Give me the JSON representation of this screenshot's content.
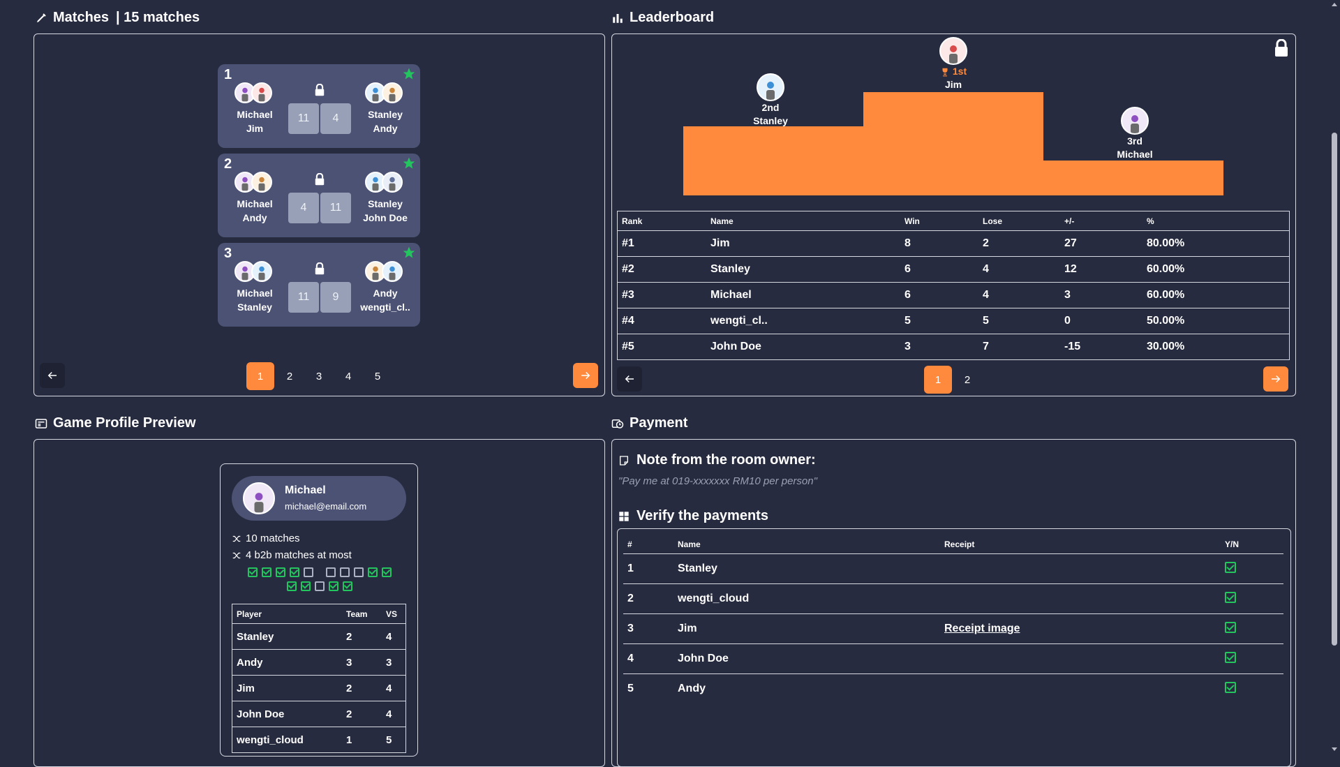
{
  "matches": {
    "title": "Matches",
    "count": "| 15 matches",
    "cards": [
      {
        "num": "1",
        "left": [
          "Michael",
          "Jim"
        ],
        "right": [
          "Stanley",
          "Andy"
        ],
        "scores": [
          "11",
          "4"
        ]
      },
      {
        "num": "2",
        "left": [
          "Michael",
          "Andy"
        ],
        "right": [
          "Stanley",
          "John Doe"
        ],
        "scores": [
          "4",
          "11"
        ]
      },
      {
        "num": "3",
        "left": [
          "Michael",
          "Stanley"
        ],
        "right": [
          "Andy",
          "wengti_cl.."
        ],
        "scores": [
          "11",
          "9"
        ]
      }
    ],
    "pages": [
      "1",
      "2",
      "3",
      "4",
      "5"
    ],
    "active_page": "1"
  },
  "leaderboard": {
    "title": "Leaderboard",
    "podium": {
      "first": {
        "rank": "1st",
        "name": "Jim"
      },
      "second": {
        "rank": "2nd",
        "name": "Stanley"
      },
      "third": {
        "rank": "3rd",
        "name": "Michael"
      }
    },
    "columns": [
      "Rank",
      "Name",
      "Win",
      "Lose",
      "+/-",
      "%"
    ],
    "rows": [
      [
        "#1",
        "Jim",
        "8",
        "2",
        "27",
        "80.00%"
      ],
      [
        "#2",
        "Stanley",
        "6",
        "4",
        "12",
        "60.00%"
      ],
      [
        "#3",
        "Michael",
        "6",
        "4",
        "3",
        "60.00%"
      ],
      [
        "#4",
        "wengti_cl..",
        "5",
        "5",
        "0",
        "50.00%"
      ],
      [
        "#5",
        "John Doe",
        "3",
        "7",
        "-15",
        "30.00%"
      ]
    ],
    "pages": [
      "1",
      "2"
    ],
    "active_page": "1"
  },
  "profile": {
    "title": "Game Profile Preview",
    "name": "Michael",
    "email": "michael@email.com",
    "matches_stat": "10 matches",
    "b2b_stat": "4 b2b matches at most",
    "streak_row1": [
      true,
      true,
      true,
      true,
      false,
      false,
      false,
      false,
      true,
      true
    ],
    "streak_row2": [
      true,
      true,
      false,
      true,
      true
    ],
    "columns": [
      "Player",
      "Team",
      "VS"
    ],
    "rows": [
      [
        "Stanley",
        "2",
        "4"
      ],
      [
        "Andy",
        "3",
        "3"
      ],
      [
        "Jim",
        "2",
        "4"
      ],
      [
        "John Doe",
        "2",
        "4"
      ],
      [
        "wengti_cloud",
        "1",
        "5"
      ]
    ]
  },
  "payment": {
    "title": "Payment",
    "note_title": "Note from the room owner:",
    "note_text": "\"Pay me at 019-xxxxxxx RM10 per person\"",
    "verify_title": "Verify the payments",
    "columns": [
      "#",
      "Name",
      "Receipt",
      "Y/N"
    ],
    "rows": [
      [
        "1",
        "Stanley",
        ""
      ],
      [
        "2",
        "wengti_cloud",
        ""
      ],
      [
        "3",
        "Jim",
        "Receipt image"
      ],
      [
        "4",
        "John Doe",
        ""
      ],
      [
        "5",
        "Andy",
        ""
      ]
    ]
  },
  "colors": {
    "background": "#272b3f",
    "card": "#4c5274",
    "accent": "#ff8a3d",
    "check": "#22c55e",
    "score_box": "#97a0b6"
  },
  "icons": [
    "pencil-icon",
    "bar-chart-icon",
    "lock-icon",
    "star-icon",
    "trophy-icon",
    "id-card-icon",
    "payment-icon",
    "note-icon",
    "grid-icon",
    "shuffle-icon",
    "arrow-left-icon",
    "arrow-right-icon"
  ]
}
